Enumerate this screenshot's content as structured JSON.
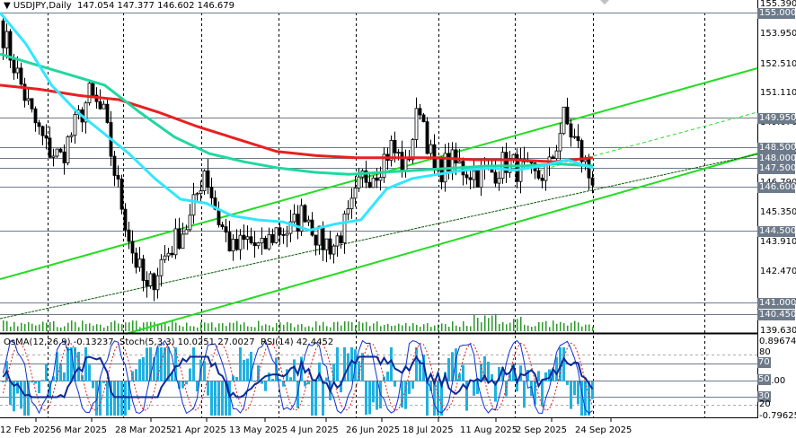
{
  "header": {
    "symbol": "USDJPY",
    "timeframe": "Daily",
    "open": "147.054",
    "high": "147.377",
    "low": "146.602",
    "close": "146.679"
  },
  "indicator_header": {
    "osma": "OsMA(12,26,9) -0.13237",
    "stoch": "Stoch(5,3,3) 10.0251 27.0027",
    "rsi": "RSI(14) 42.4452"
  },
  "price_axis": [
    "155.390",
    "153.950",
    "152.510",
    "151.110",
    "149.670",
    "148.230",
    "146.790",
    "145.350",
    "143.910",
    "142.470",
    "141.030",
    "139.630"
  ],
  "levels": [
    "155.000",
    "149.950",
    "148.500",
    "148.000",
    "147.500",
    "146.600",
    "144.500",
    "141.000",
    "140.450"
  ],
  "indicator_axis": {
    "max": "0.89674",
    "min": "-0.79625",
    "zero": "0.00",
    "l80": "80",
    "l70": "70",
    "l50": "50",
    "l30": "30",
    "l20": "20"
  },
  "dates": [
    "12 Feb 2025",
    "6 Mar 2025",
    "28 Mar 2025",
    "21 Apr 2025",
    "13 May 2025",
    "4 Jun 2025",
    "26 Jun 2025",
    "18 Jul 2025",
    "11 Aug 2025",
    "2 Sep 2025",
    "24 Sep 2025"
  ],
  "colors": {
    "bull": "#ffffff",
    "bear": "#000000",
    "ma_fast": "#33e6ff",
    "ma_mid": "#20d8a0",
    "ma_slow": "#e82020",
    "channel": "#22dd22",
    "level": "#6d7a8a",
    "osma": "#20b0e0",
    "stoch_main": "#1030d0",
    "stoch_signal": "#e02020",
    "rsi": "#0a2a9a"
  },
  "chart_data": {
    "type": "candlestick",
    "weekly_closes": [
      154.0,
      152.0,
      150.0,
      148.5,
      148.0,
      149.5,
      151.0,
      150.0,
      146.5,
      143.5,
      141.5,
      143.0,
      144.0,
      145.0,
      147.5,
      145.0,
      143.5,
      144.0,
      143.5,
      144.5,
      144.5,
      145.5,
      144.0,
      143.8,
      145.0,
      147.0,
      147.5,
      148.5,
      147.5,
      150.6,
      147.2,
      147.8,
      147.5,
      147.2,
      147.3,
      147.8,
      147.4,
      147.0,
      147.5,
      149.9,
      148.5,
      146.68
    ],
    "ma_fast": [
      155.0,
      153.5,
      151.5,
      150.2,
      149.2,
      148.2,
      147.0,
      146.0,
      145.8,
      145.2,
      145.0,
      144.9,
      144.5,
      144.8,
      145.0,
      146.5,
      147.0,
      147.2,
      147.4,
      147.5,
      147.4,
      147.6,
      147.9,
      147.5
    ],
    "ma_mid": [
      153.0,
      152.5,
      152.0,
      151.5,
      150.2,
      149.0,
      148.2,
      147.8,
      147.5,
      147.3,
      147.2,
      147.3,
      147.4,
      147.5,
      147.6,
      147.6,
      147.7,
      147.6
    ],
    "ma_slow": [
      151.5,
      151.3,
      151.0,
      150.8,
      150.2,
      149.5,
      148.9,
      148.3,
      148.1,
      148.0,
      148.0,
      148.0,
      147.9,
      147.9,
      147.8,
      148.0
    ]
  }
}
